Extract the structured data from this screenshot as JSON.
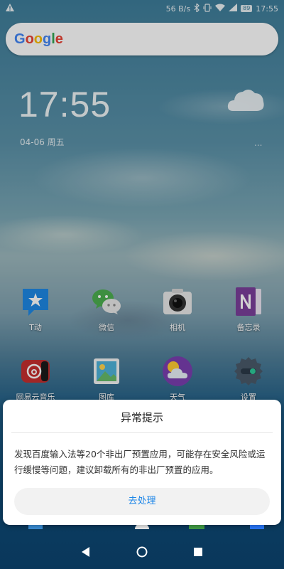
{
  "status_bar": {
    "left_icon": "warning-icon",
    "speed": "56 B/s",
    "battery": "89",
    "time": "17:55"
  },
  "google_search": {
    "logo_text": [
      "G",
      "o",
      "o",
      "g",
      "l",
      "e"
    ],
    "logo_colors": [
      "#4285F4",
      "#EA4335",
      "#FBBC05",
      "#4285F4",
      "#34A853",
      "#EA4335"
    ]
  },
  "clock_widget": {
    "time": "17:55",
    "date": "04-06 周五",
    "weather_icon": "cloud-icon",
    "more": "..."
  },
  "apps": [
    {
      "label": "T动",
      "icon": "star-message-icon"
    },
    {
      "label": "微信",
      "icon": "wechat-icon"
    },
    {
      "label": "相机",
      "icon": "camera-icon"
    },
    {
      "label": "备忘录",
      "icon": "onenote-icon"
    },
    {
      "label": "网易云音乐",
      "icon": "netease-music-icon"
    },
    {
      "label": "图库",
      "icon": "gallery-icon"
    },
    {
      "label": "天气",
      "icon": "weather-icon"
    },
    {
      "label": "设置",
      "icon": "settings-icon"
    }
  ],
  "dialog": {
    "title": "异常提示",
    "message": "发现百度输入法等20个非出厂预置应用，可能存在安全风险或运行缓慢等问题，建议卸载所有的非出厂预置的应用。",
    "button": "去处理"
  },
  "nav_bar": {
    "back": "back-icon",
    "home": "home-icon",
    "recents": "recents-icon"
  }
}
